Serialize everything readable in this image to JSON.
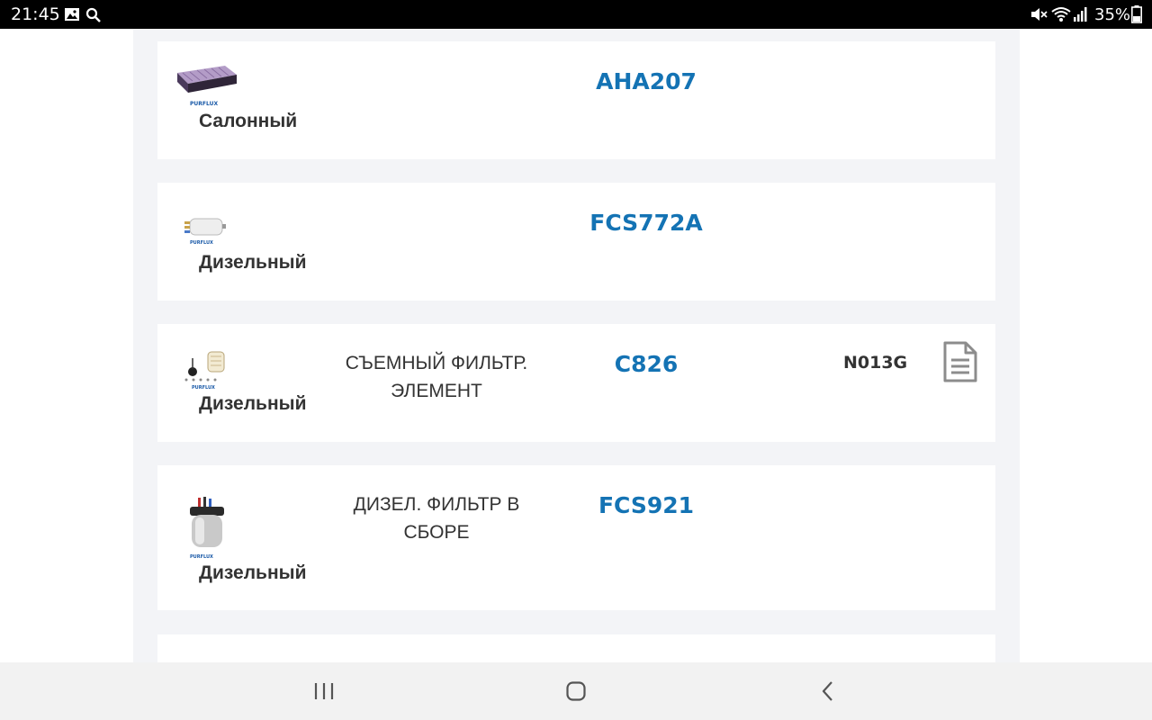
{
  "status_bar": {
    "time": "21:45",
    "battery": "35%",
    "icons": [
      "image-icon",
      "search-icon",
      "mute-icon",
      "wifi-icon",
      "signal-icon",
      "battery-icon"
    ]
  },
  "accent_color": "#1473b4",
  "products": [
    {
      "type": "Салонный",
      "description_lines": [],
      "part_number": "AHA207",
      "code": "",
      "has_document": false,
      "thumb": "cabin-filter-thumbnail"
    },
    {
      "type": "Дизельный",
      "description_lines": [],
      "part_number": "FCS772A",
      "code": "",
      "has_document": false,
      "thumb": "fuel-filter-thumbnail"
    },
    {
      "type": "Дизельный",
      "description_lines": [
        "СЪЕМНЫЙ ФИЛЬТР.",
        "ЭЛЕМЕНТ"
      ],
      "part_number": "C826",
      "code": "N013G",
      "has_document": true,
      "thumb": "filter-element-thumbnail"
    },
    {
      "type": "Дизельный",
      "description_lines": [
        "ДИЗЕЛ. ФИЛЬТР В СБОРЕ"
      ],
      "part_number": "FCS921",
      "code": "",
      "has_document": false,
      "thumb": "filter-assembly-thumbnail"
    }
  ],
  "nav_bar": {
    "buttons": [
      "recent-apps-button",
      "home-button",
      "back-button"
    ]
  }
}
